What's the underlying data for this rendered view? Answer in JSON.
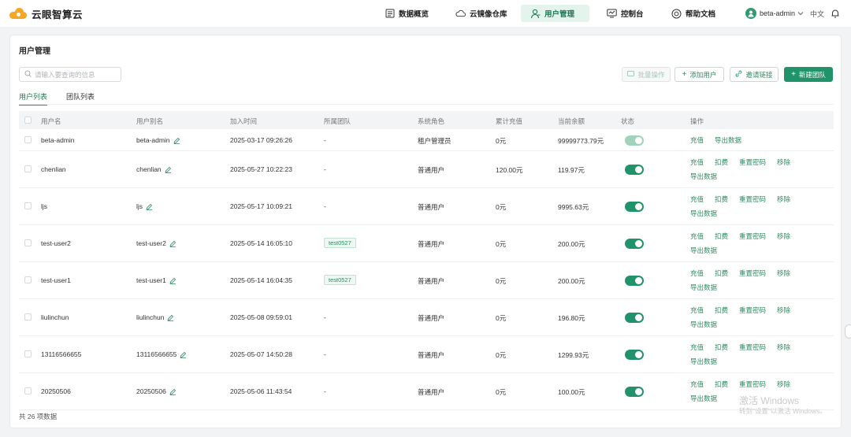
{
  "app": {
    "name": "云眼智算云"
  },
  "nav": [
    {
      "label": "数据概览",
      "icon": "dashboard-icon"
    },
    {
      "label": "云镜像仓库",
      "icon": "cloud-icon"
    },
    {
      "label": "用户管理",
      "icon": "users-icon",
      "active": true
    },
    {
      "label": "控制台",
      "icon": "monitor-icon"
    },
    {
      "label": "帮助文档",
      "icon": "help-icon"
    }
  ],
  "user": {
    "name": "beta-admin",
    "lang": "中文"
  },
  "page": {
    "title": "用户管理"
  },
  "search": {
    "placeholder": "请输入要查询的信息"
  },
  "toolbar": {
    "batch_label": "批量操作",
    "add_user_label": "添加用户",
    "invite_label": "邀请链接",
    "new_team_label": "新建团队"
  },
  "tabs": [
    {
      "label": "用户列表",
      "active": true
    },
    {
      "label": "团队列表",
      "active": false
    }
  ],
  "table": {
    "columns": [
      "用户名",
      "用户别名",
      "加入时间",
      "所属团队",
      "系统角色",
      "累计充值",
      "当前余额",
      "状态",
      "操作"
    ],
    "rows": [
      {
        "username": "beta-admin",
        "alias": "beta-admin",
        "joined": "2025-03-17 09:26:26",
        "team": "-",
        "role": "租户管理员",
        "recharge": "0元",
        "balance": "99999773.79元",
        "status": "enabled",
        "actions": [
          "充值",
          "导出数据"
        ]
      },
      {
        "username": "chenlian",
        "alias": "chenlian",
        "joined": "2025-05-27 10:22:23",
        "team": "-",
        "role": "普通用户",
        "recharge": "120.00元",
        "balance": "119.97元",
        "status": "enabled",
        "actions": [
          "充值",
          "扣费",
          "重置密码",
          "移除",
          "导出数据"
        ]
      },
      {
        "username": "ljs",
        "alias": "ljs",
        "joined": "2025-05-17 10:09:21",
        "team": "-",
        "role": "普通用户",
        "recharge": "0元",
        "balance": "9995.63元",
        "status": "enabled",
        "actions": [
          "充值",
          "扣费",
          "重置密码",
          "移除",
          "导出数据"
        ]
      },
      {
        "username": "test-user2",
        "alias": "test-user2",
        "joined": "2025-05-14 16:05:10",
        "team": "test0527",
        "role": "普通用户",
        "recharge": "0元",
        "balance": "200.00元",
        "status": "enabled",
        "actions": [
          "充值",
          "扣费",
          "重置密码",
          "移除",
          "导出数据"
        ]
      },
      {
        "username": "test-user1",
        "alias": "test-user1",
        "joined": "2025-05-14 16:04:35",
        "team": "test0527",
        "role": "普通用户",
        "recharge": "0元",
        "balance": "200.00元",
        "status": "enabled",
        "actions": [
          "充值",
          "扣费",
          "重置密码",
          "移除",
          "导出数据"
        ]
      },
      {
        "username": "liulinchun",
        "alias": "liulinchun",
        "joined": "2025-05-08 09:59:01",
        "team": "-",
        "role": "普通用户",
        "recharge": "0元",
        "balance": "196.80元",
        "status": "enabled",
        "actions": [
          "充值",
          "扣费",
          "重置密码",
          "移除",
          "导出数据"
        ]
      },
      {
        "username": "13116566655",
        "alias": "13116566655",
        "joined": "2025-05-07 14:50:28",
        "team": "-",
        "role": "普通用户",
        "recharge": "0元",
        "balance": "1299.93元",
        "status": "enabled",
        "actions": [
          "充值",
          "扣费",
          "重置密码",
          "移除",
          "导出数据"
        ]
      },
      {
        "username": "20250506",
        "alias": "20250506",
        "joined": "2025-05-06 11:43:54",
        "team": "-",
        "role": "普通用户",
        "recharge": "0元",
        "balance": "100.00元",
        "status": "enabled",
        "actions": [
          "充值",
          "扣费",
          "重置密码",
          "移除",
          "导出数据"
        ]
      }
    ]
  },
  "footer": {
    "total": "共 26 项数据"
  },
  "watermark": {
    "line1": "激活 Windows",
    "line2": "转到\"设置\"以激活 Windows。"
  },
  "colors": {
    "accent": "#21936a",
    "accent_light": "#e4f3ec",
    "brand": "#f5a623"
  }
}
